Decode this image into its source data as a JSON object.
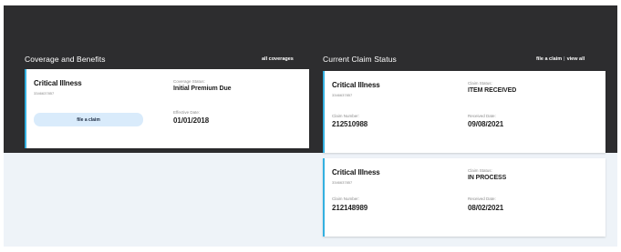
{
  "coverage": {
    "title": "Coverage and Benefits",
    "all_link": "all coverages",
    "card": {
      "title": "Critical Illness",
      "policy": "3346637857",
      "status_label": "Coverage Status:",
      "status_value": "Initial Premium Due",
      "effective_label": "Effective Date:",
      "effective_value": "01/01/2018",
      "button": "file a claim"
    }
  },
  "claims": {
    "title": "Current Claim Status",
    "file_link": "file a claim",
    "separator": "|",
    "view_link": "view all",
    "cards": [
      {
        "title": "Critical Illness",
        "policy": "3346637857",
        "number_label": "Claim Number:",
        "number_value": "212510988",
        "status_label": "Claim Status:",
        "status_value": "ITEM RECEIVED",
        "received_label": "Received Date:",
        "received_value": "09/08/2021"
      },
      {
        "title": "Critical Illness",
        "policy": "3346637857",
        "number_label": "Claim Number:",
        "number_value": "212148989",
        "status_label": "Claim Status:",
        "status_value": "IN PROCESS",
        "received_label": "Received Date:",
        "received_value": "08/02/2021"
      }
    ]
  },
  "colors": {
    "header_band": "#2d2d2f",
    "accent_border": "#34b0e0",
    "button_bg": "#d9ebfb",
    "page_bg": "#eef3f8"
  }
}
